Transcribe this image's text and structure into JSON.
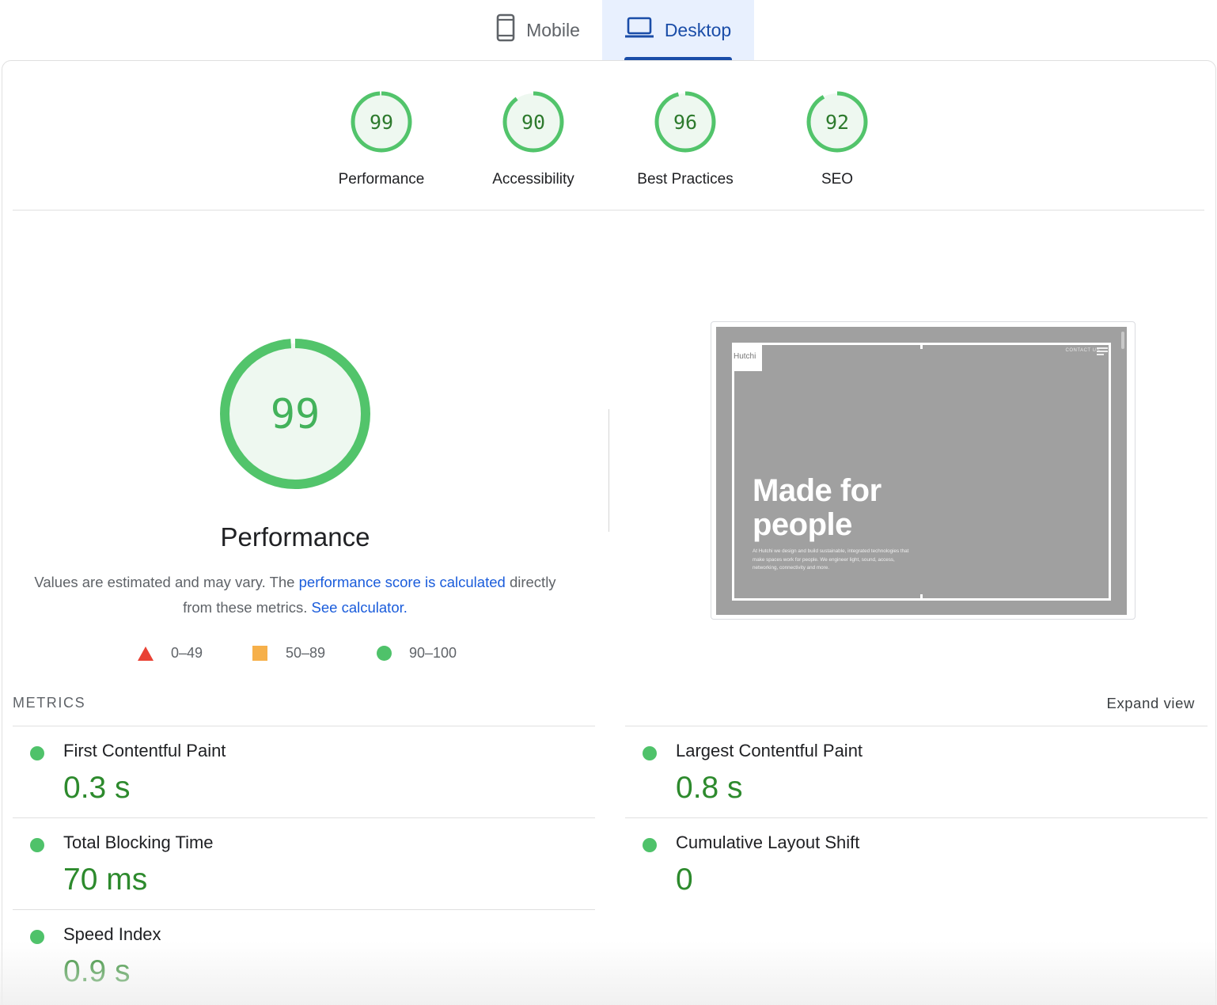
{
  "tabs": {
    "mobile": "Mobile",
    "desktop": "Desktop",
    "active": "Desktop"
  },
  "categories": [
    {
      "score": "99",
      "label": "Performance",
      "value": 99
    },
    {
      "score": "90",
      "label": "Accessibility",
      "value": 90
    },
    {
      "score": "96",
      "label": "Best Practices",
      "value": 96
    },
    {
      "score": "92",
      "label": "SEO",
      "value": 92
    }
  ],
  "performance": {
    "score": "99",
    "value": 99,
    "title": "Performance",
    "desc_prefix": "Values are estimated and may vary. The ",
    "desc_link1": "performance score is calculated",
    "desc_middle": " directly from these metrics. ",
    "desc_link2": "See calculator.",
    "legend": {
      "fail": "0–49",
      "average": "50–89",
      "pass": "90–100"
    }
  },
  "screenshot": {
    "logo": "Hutchi",
    "nav": "CONTACT US",
    "headline_line1": "Made for",
    "headline_line2": "people",
    "subtext": "At Hutchi we design and build sustainable, integrated technologies that make spaces work for people. We engineer light, sound, access, networking, connectivity and more."
  },
  "metrics": {
    "title": "METRICS",
    "expand": "Expand view",
    "items": [
      {
        "name": "First Contentful Paint",
        "value": "0.3 s"
      },
      {
        "name": "Largest Contentful Paint",
        "value": "0.8 s"
      },
      {
        "name": "Total Blocking Time",
        "value": "70 ms"
      },
      {
        "name": "Cumulative Layout Shift",
        "value": "0"
      },
      {
        "name": "Speed Index",
        "value": "0.9 s"
      }
    ]
  },
  "colors": {
    "pass": "#0cce6b",
    "pass_text": "#2d8a2d",
    "gauge_fill": "#eef8f0",
    "average": "#f6b04a",
    "fail": "#e94235",
    "link": "#1a5cdb",
    "tab_active": "#1a4da8"
  }
}
